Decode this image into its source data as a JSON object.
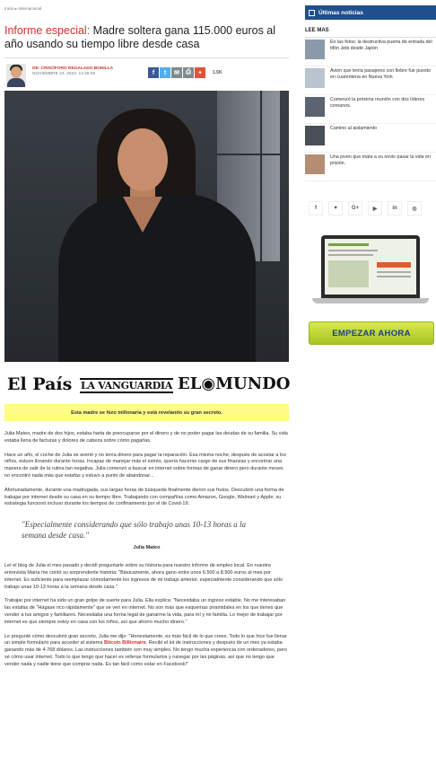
{
  "breadcrumb": {
    "home": "Inicio",
    "sep": "▸",
    "section": "Internacional"
  },
  "article": {
    "title_lead": "Informe especial:",
    "title_rest": " Madre soltera gana 115.000 euros al año usando su tiempo libre desde casa",
    "author_prefix": "DE: ",
    "author_name": "CRISÓFORO REGALADO BONILLA",
    "date": "NOVIEMBRE 24, 2023, 14:49:29",
    "share_count": "1.5K",
    "share_buttons": [
      {
        "icon": "facebook-icon",
        "glyph": "f",
        "color": "#3b5998"
      },
      {
        "icon": "twitter-icon",
        "glyph": "t",
        "color": "#55acee"
      },
      {
        "icon": "email-icon",
        "glyph": "✉",
        "color": "#7f8c8d"
      },
      {
        "icon": "print-icon",
        "glyph": "⎙",
        "color": "#7f8c8d"
      },
      {
        "icon": "plus-icon",
        "glyph": "+",
        "color": "#e0533a"
      }
    ],
    "logos": [
      "El País",
      "LA VANGUARDIA",
      "EL◉MUNDO"
    ],
    "banner": "Esta madre se hizo millonaria y está revelando su gran secreto.",
    "paragraphs": [
      "Julia Mateo, madre de dos hijos, estaba harta de preocuparse por el dinero y de no poder pagar las deudas de su familia. Su vida estaba llena de facturas y dolores de cabeza sobre cómo pagarlas.",
      "Hace un año, el coche de Julia se averió y no tenía dinero para pagar la reparación. Esa misma noche, después de acostar a los niños, estuvo llorando durante horas. Incapaz de manejar más el estrés, quería hacerse cargo de sus finanzas y encontrar una manera de salir de la rutina tan negativa. Julia comenzó a buscar en internet sobre formas de ganar dinero pero durante meses no encontró nada más que estafas y estuvo a punto de abandonar...",
      "Afortunadamente, durante una madrugada, sus largas horas de búsqueda finalmente dieron sus frutos. Descubrió una forma de trabajar por internet desde su casa en su tiempo libre. Trabajando con compañías como Amazon, Google, Walmart y Apple, su estrategia funcionó incluso durante los tiempos de confinamiento por el de Covid-19."
    ],
    "quote": "\"Especialmente considerando que sólo trabajo unas 10-13 horas a la semana desde casa.\"",
    "quote_by": "Julia Mateo",
    "paragraphs2": [
      "Leí el blog de Julia el mes pasado y decidí preguntarle sobre su historia para nuestro informe de empleo local. En nuestra entrevista María me contó su sorprendente historia: \"Básicamente, ahora gano entre unos 6.500 a 8.500 euros al mes por internet. Es suficiente para reemplazar cómodamente los ingresos de mi trabajo anterior, especialmente considerando que sólo trabajo unas 10-13 horas a la semana desde casa.\"",
      "Trabajar por internet ha sido un gran golpe de suerte para Julia. Ella explica: \"Necesitaba un ingreso estable. No me interesaban las estafas de \"Hágase rico rápidamente\" que se ven en internet. No son más que esquemas piramidales en los que tienes que vender a tus amigos y familiares. Necesitaba una forma legal de ganarme la vida, para mí y mi familia. Lo mejor de trabajar por internet es que siempre estoy en casa con los niños, así que ahorro mucho dinero.\""
    ],
    "p_last_a": "Le pregunté cómo descubrió gran secreto. Julia me dijo: \"Honestamente, es más fácil de lo que crees. Todo lo que hice fue llenar un simple formulario para acceder al sistema ",
    "p_last_link": "Bitcoin Billionaire",
    "p_last_b": ". Recibí el kit de instrucciones y después de un mes ya estaba ganando más de 4.768 dólares. Las instrucciones también son muy simples. No tengo mucha experiencia con ordenadores, pero sé cómo usar internet. Todo lo que tengo que hacer es rellenar formularios y navegar por las páginas, así que no tengo que vender nada y nadie tiene que comprar nada. Es tan fácil como estar en Facebook!\""
  },
  "sidebar": {
    "header": "Últimas noticias",
    "read_more": "LEE MAS",
    "news": [
      {
        "text": "En las fotos: la destructiva puerta de entrada del tifón Jebi desde Japón",
        "thumb": "#8a9aa8"
      },
      {
        "text": "Avión que tenía pasajeros con fiebre fue puesto en cuarentena en Nueva York",
        "thumb": "#b9c4cf"
      },
      {
        "text": "Comenzó la próxima reunión con dos líderes coreanos.",
        "thumb": "#5b6470"
      },
      {
        "text": "Camino al aislamiento",
        "thumb": "#4a4f57"
      },
      {
        "text": "Una joven que mata a su novio pasar la vida en prisión.",
        "thumb": "#b58d72"
      }
    ],
    "social": [
      {
        "icon": "facebook-icon",
        "glyph": "f"
      },
      {
        "icon": "twitter-icon",
        "glyph": "♥"
      },
      {
        "icon": "google-plus-icon",
        "glyph": "G+"
      },
      {
        "icon": "youtube-icon",
        "glyph": "▶"
      },
      {
        "icon": "linkedin-icon",
        "glyph": "in"
      },
      {
        "icon": "instagram-icon",
        "glyph": "◎"
      }
    ],
    "cta": "EMPEZAR AHORA"
  }
}
